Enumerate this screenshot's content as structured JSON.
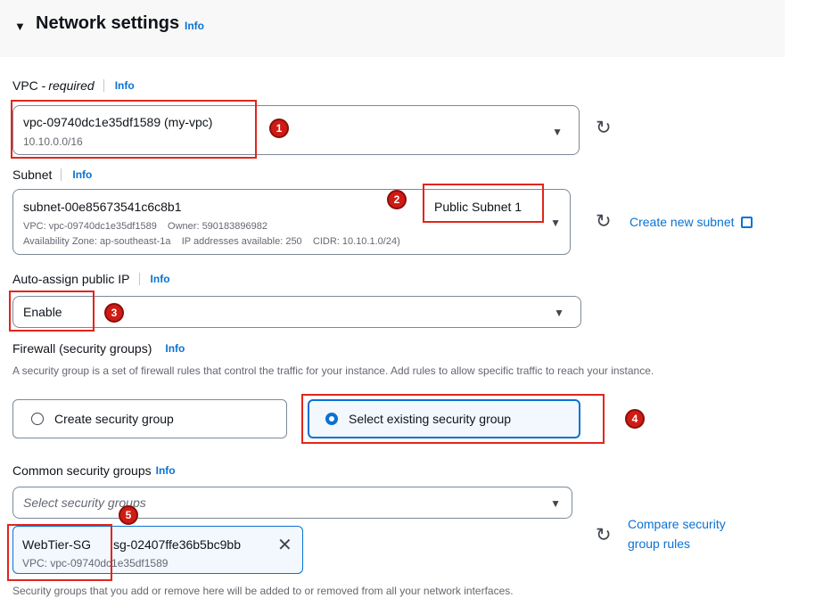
{
  "section": {
    "title": "Network settings",
    "info": "Info"
  },
  "vpc": {
    "label": "VPC - ",
    "required": "required",
    "info": "Info",
    "value": "vpc-09740dc1e35df1589 (my-vpc)",
    "cidr": "10.10.0.0/16"
  },
  "subnet": {
    "label": "Subnet",
    "info": "Info",
    "id": "subnet-00e85673541c6c8b1",
    "name": "Public Subnet 1",
    "vpc_line": "VPC: vpc-09740dc1e35df1589    Owner: 590183896982",
    "az_line": "Availability Zone: ap-southeast-1a    IP addresses available: 250    CIDR: 10.10.1.0/24)",
    "create_link": "Create new subnet"
  },
  "auto_ip": {
    "label": "Auto-assign public IP",
    "info": "Info",
    "value": "Enable"
  },
  "firewall": {
    "label": "Firewall (security groups)",
    "info": "Info",
    "description": "A security group is a set of firewall rules that control the traffic for your instance. Add rules to allow specific traffic to reach your instance.",
    "options": [
      "Create security group",
      "Select existing security group"
    ],
    "selected": "Select existing security group"
  },
  "common_sg": {
    "label": "Common security groups",
    "info": "Info",
    "placeholder": "Select security groups",
    "compare_link_line1": "Compare security",
    "compare_link_line2": "group rules",
    "token": {
      "name": "WebTier-SG",
      "id": "sg-02407ffe36b5bc9bb",
      "vpc": "VPC: vpc-09740dc1e35df1589"
    },
    "footer": "Security groups that you add or remove here will be added to or removed from all your network interfaces."
  },
  "annotations": [
    "1",
    "2",
    "3",
    "4",
    "5"
  ],
  "colors": {
    "link": "#0972d3",
    "annotation": "#e2251c",
    "text": "#0f141a"
  },
  "icons": [
    "collapse-caret-icon",
    "dropdown-arrow-icon",
    "refresh-icon",
    "external-link-icon",
    "radio-icon",
    "remove-x-icon"
  ]
}
